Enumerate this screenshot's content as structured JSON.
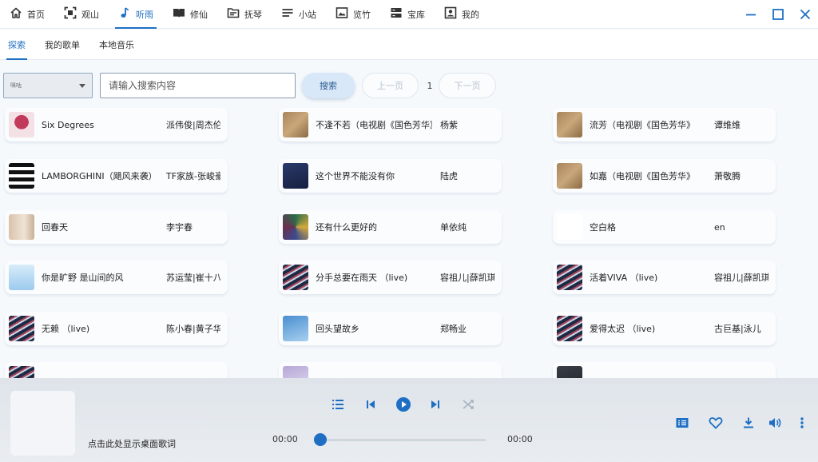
{
  "nav": {
    "items": [
      {
        "label": "首页",
        "icon": "home-icon"
      },
      {
        "label": "观山",
        "icon": "scan-icon"
      },
      {
        "label": "听雨",
        "icon": "music-note-icon"
      },
      {
        "label": "修仙",
        "icon": "book-icon"
      },
      {
        "label": "抚琴",
        "icon": "folder-icon"
      },
      {
        "label": "小站",
        "icon": "menu-lines-icon"
      },
      {
        "label": "览竹",
        "icon": "image-icon"
      },
      {
        "label": "宝库",
        "icon": "storage-icon"
      },
      {
        "label": "我的",
        "icon": "user-icon"
      }
    ],
    "active_index": 2
  },
  "subtabs": {
    "items": [
      "探索",
      "我的歌单",
      "本地音乐"
    ],
    "active_index": 0
  },
  "search": {
    "source_value": "咪咕",
    "placeholder": "请输入搜索内容",
    "search_label": "搜索",
    "prev_label": "上一页",
    "page": "1",
    "next_label": "下一页"
  },
  "songs": [
    {
      "title": "Six Degrees",
      "artist": "派伟俊|周杰伦",
      "cover": "bouquet"
    },
    {
      "title": "不逢不若（电视剧《国色芳华》",
      "artist": "杨紫",
      "cover": "sepia"
    },
    {
      "title": "流芳（电视剧《国色芳华》",
      "artist": "谭维维",
      "cover": "sepia"
    },
    {
      "title": "LAMBORGHINI（飓风来袭）",
      "artist": "TF家族-张峻豪",
      "cover": "bwtext"
    },
    {
      "title": "这个世界不能没有你",
      "artist": "陆虎",
      "cover": "navy"
    },
    {
      "title": "如嘉（电视剧《国色芳华》",
      "artist": "萧敬腾",
      "cover": "sepia"
    },
    {
      "title": "回春天",
      "artist": "李宇春",
      "cover": "beige"
    },
    {
      "title": "还有什么更好的",
      "artist": "单依纯",
      "cover": "colorful"
    },
    {
      "title": "空白格",
      "artist": "en",
      "cover": "script"
    },
    {
      "title": "你是旷野 是山间的风",
      "artist": "苏运莹|崔十八",
      "cover": "sky"
    },
    {
      "title": "分手总要在雨天 （live)",
      "artist": "容祖儿|薛凯琪",
      "cover": "stripes"
    },
    {
      "title": "活着VIVA （live)",
      "artist": "容祖儿|薛凯琪",
      "cover": "stripes"
    },
    {
      "title": "无赖 （live)",
      "artist": "陈小春|黄子华",
      "cover": "stripes"
    },
    {
      "title": "回头望故乡",
      "artist": "郑畅业",
      "cover": "blue"
    },
    {
      "title": "爱得太迟 （live)",
      "artist": "古巨基|泳儿",
      "cover": "stripes"
    },
    {
      "title": "",
      "artist": "",
      "cover": "stripes"
    },
    {
      "title": "",
      "artist": "",
      "cover": "lavender"
    },
    {
      "title": "",
      "artist": "",
      "cover": "dark"
    }
  ],
  "player": {
    "lyric_hint": "点击此处显示桌面歌词",
    "time_current": "00:00",
    "time_total": "00:00",
    "progress": 0
  },
  "colors": {
    "accent": "#1e6fc4",
    "background": "#f6f9fc",
    "player_background": "#e3e8ed"
  }
}
